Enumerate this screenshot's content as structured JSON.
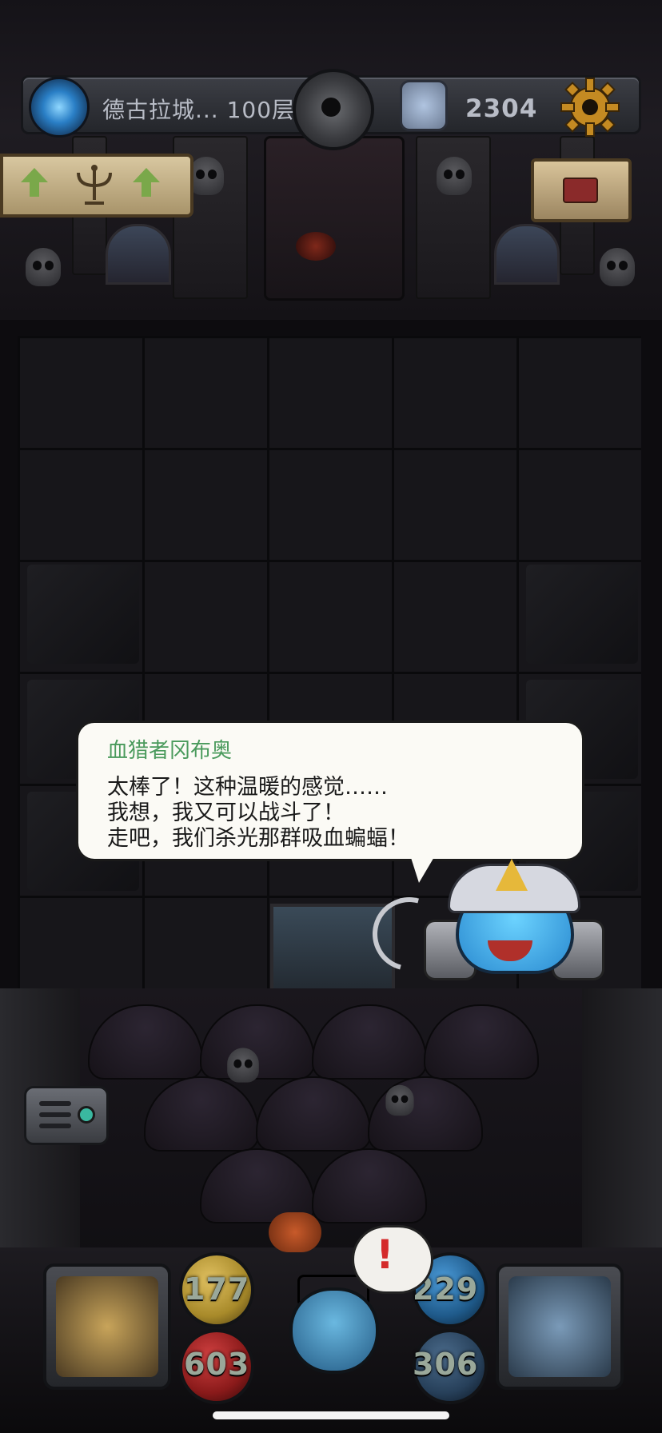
{
  "hud_top": {
    "floor_name": "德古拉城... 100层",
    "coins": "2304",
    "icons": [
      "portal-icon",
      "medal-icon",
      "coin-icon",
      "gear-icon"
    ]
  },
  "dialog": {
    "speaker": "血猎者冈布奥",
    "lines": [
      "太棒了！这种温暖的感觉……",
      "我想，我又可以战斗了！",
      "走吧，我们杀光那群吸血蝙蝠！"
    ],
    "speaker_color": "#4a9a5c"
  },
  "stats": {
    "attack": "177",
    "hp": "603",
    "defense": "229",
    "mana": "306"
  },
  "alert": {
    "mark": "!"
  },
  "colors": {
    "hp_orb": "#8a1a1a",
    "attack_orb": "#a88a2a",
    "defense_orb": "#1f5a8a",
    "mana_orb": "#27405a"
  }
}
